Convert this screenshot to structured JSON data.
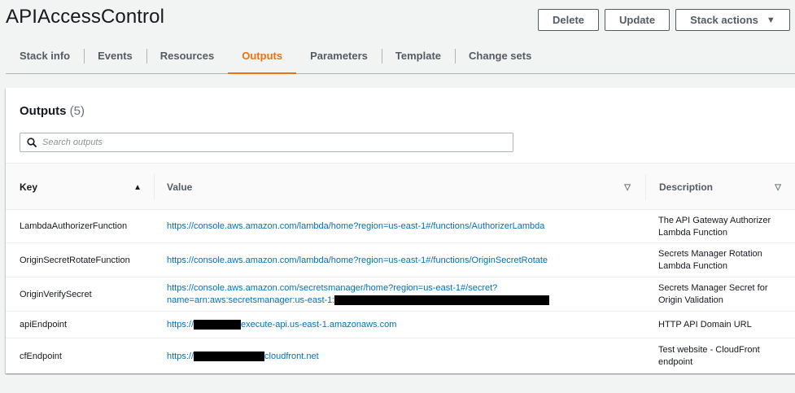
{
  "stack": {
    "name": "APIAccessControl"
  },
  "actions": {
    "delete_label": "Delete",
    "update_label": "Update",
    "stack_actions_label": "Stack actions",
    "caret": "▼"
  },
  "tabs": [
    {
      "label": "Stack info"
    },
    {
      "label": "Events"
    },
    {
      "label": "Resources"
    },
    {
      "label": "Outputs",
      "active": true
    },
    {
      "label": "Parameters"
    },
    {
      "label": "Template"
    },
    {
      "label": "Change sets"
    }
  ],
  "outputs": {
    "title": "Outputs",
    "count": "(5)",
    "search_placeholder": "Search outputs",
    "columns": {
      "key": "Key",
      "value": "Value",
      "description": "Description",
      "sort_asc": "▲",
      "sort_none": "▽"
    },
    "rows": [
      {
        "key": "LambdaAuthorizerFunction",
        "value": "https://console.aws.amazon.com/lambda/home?region=us-east-1#/functions/AuthorizerLambda",
        "description": "The API Gateway Authorizer Lambda Function"
      },
      {
        "key": "OriginSecretRotateFunction",
        "value": "https://console.aws.amazon.com/lambda/home?region=us-east-1#/functions/OriginSecretRotate",
        "description": "Secrets Manager Rotation Lambda Function"
      },
      {
        "key": "OriginVerifySecret",
        "value_line1": "https://console.aws.amazon.com/secretsmanager/home?region=us-east-1#/secret?",
        "value_line2": "name=arn:aws:secretsmanager:us-east-1:",
        "description": "Secrets Manager Secret for Origin Validation"
      },
      {
        "key": "apiEndpoint",
        "value_prefix": "https://",
        "value_suffix": "execute-api.us-east-1.amazonaws.com",
        "description": "HTTP API Domain URL"
      },
      {
        "key": "cfEndpoint",
        "value_prefix": "https://",
        "value_suffix": "cloudfront.net",
        "description": "Test website - CloudFront endpoint"
      }
    ]
  },
  "colors": {
    "accent": "#ec7211",
    "link": "#0073bb",
    "background": "#f2f3f3"
  }
}
